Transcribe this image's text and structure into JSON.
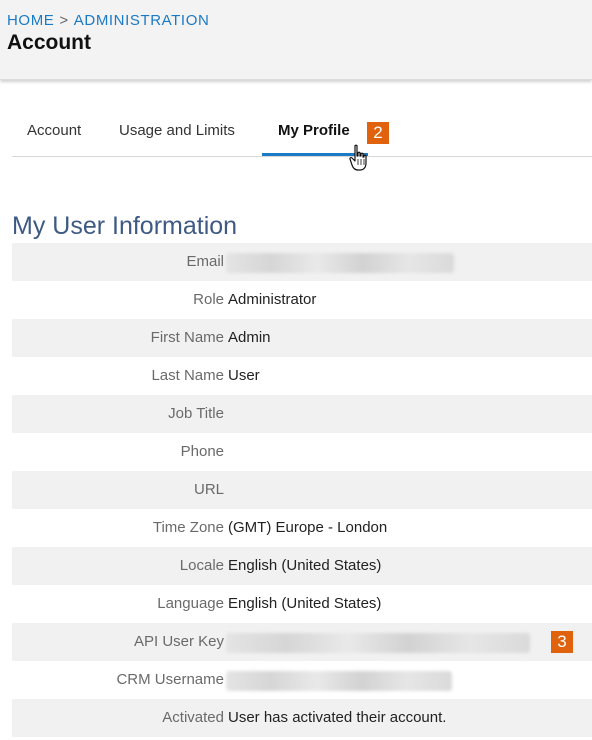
{
  "breadcrumb": {
    "home": "HOME",
    "separator": ">",
    "current": "ADMINISTRATION"
  },
  "page_title": "Account",
  "tabs": [
    {
      "label": "Account",
      "active": false
    },
    {
      "label": "Usage and Limits",
      "active": false
    },
    {
      "label": "My Profile",
      "active": true
    }
  ],
  "badges": {
    "tab_step": "2",
    "api_key_step": "3"
  },
  "section_title": "My User Information",
  "fields": [
    {
      "label": "Email",
      "value": "",
      "redacted": true
    },
    {
      "label": "Role",
      "value": "Administrator"
    },
    {
      "label": "First Name",
      "value": "Admin"
    },
    {
      "label": "Last Name",
      "value": "User"
    },
    {
      "label": "Job Title",
      "value": ""
    },
    {
      "label": "Phone",
      "value": ""
    },
    {
      "label": "URL",
      "value": ""
    },
    {
      "label": "Time Zone",
      "value": "(GMT) Europe - London"
    },
    {
      "label": "Locale",
      "value": "English (United States)"
    },
    {
      "label": "Language",
      "value": "English (United States)"
    },
    {
      "label": "API User Key",
      "value": "",
      "redacted": true
    },
    {
      "label": "CRM Username",
      "value": "",
      "redacted": true
    },
    {
      "label": "Activated",
      "value": "User has activated their account."
    }
  ],
  "colors": {
    "accent": "#1b7ac6",
    "badge": "#e0620d",
    "section_title": "#3e5a84",
    "row_shade": "#f1f1f1"
  },
  "icons": {
    "cursor": "hand-pointer-icon"
  }
}
